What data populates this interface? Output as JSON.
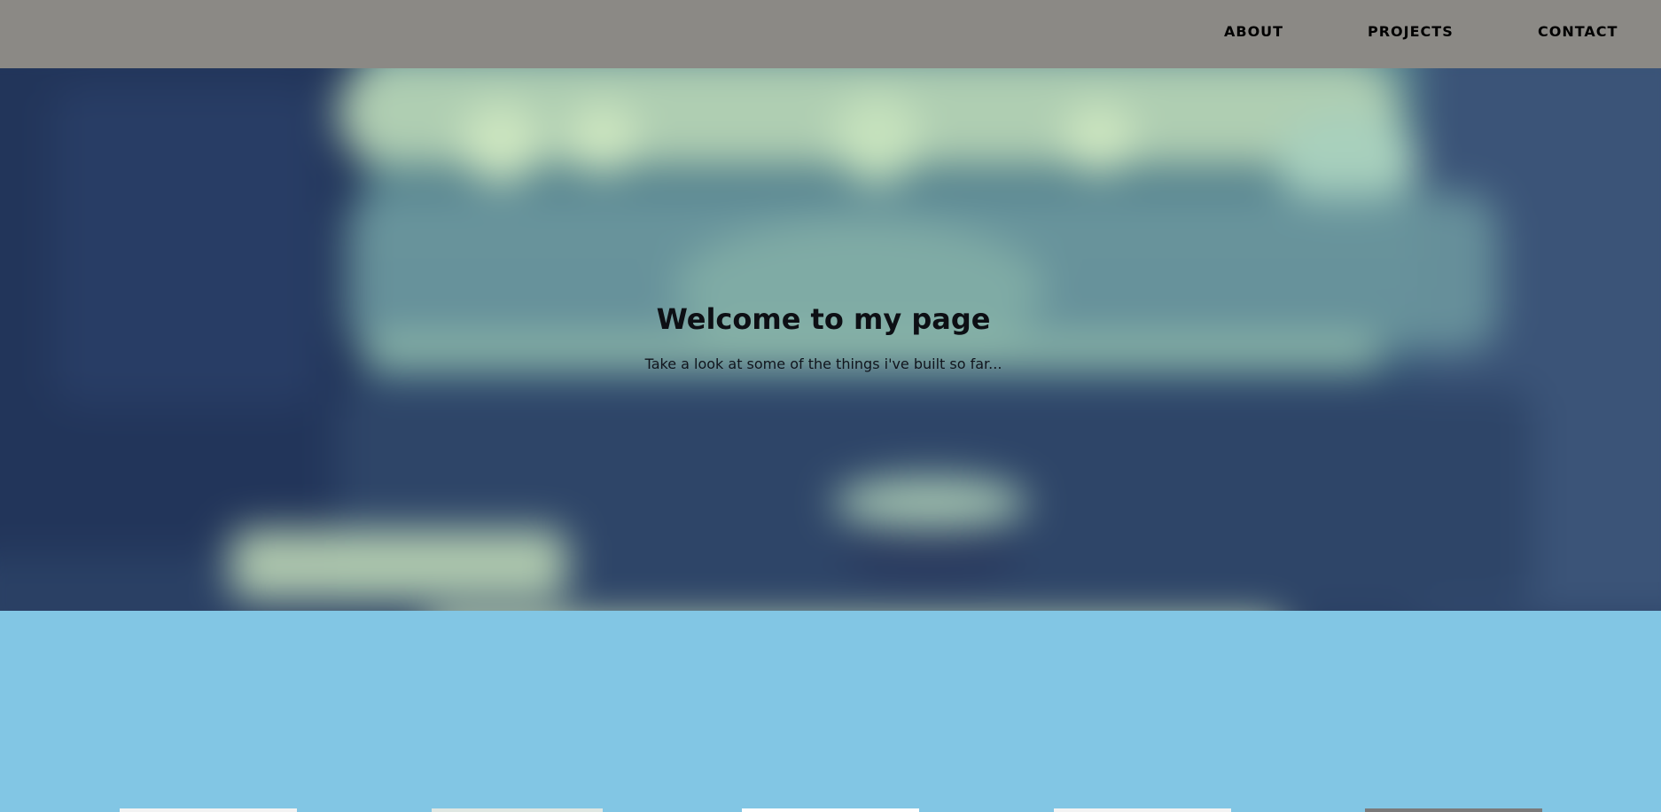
{
  "nav": {
    "items": [
      {
        "label": "ABOUT"
      },
      {
        "label": "PROJECTS"
      },
      {
        "label": "CONTACT"
      }
    ]
  },
  "hero": {
    "title": "Welcome to my page",
    "subtitle": "Take a look at some of the things i've built so far..."
  },
  "colors": {
    "navbar": "#8b8985",
    "hero_base": "#2f4a6c",
    "section_bg": "#82c6e4",
    "text": "#0d0f14"
  }
}
